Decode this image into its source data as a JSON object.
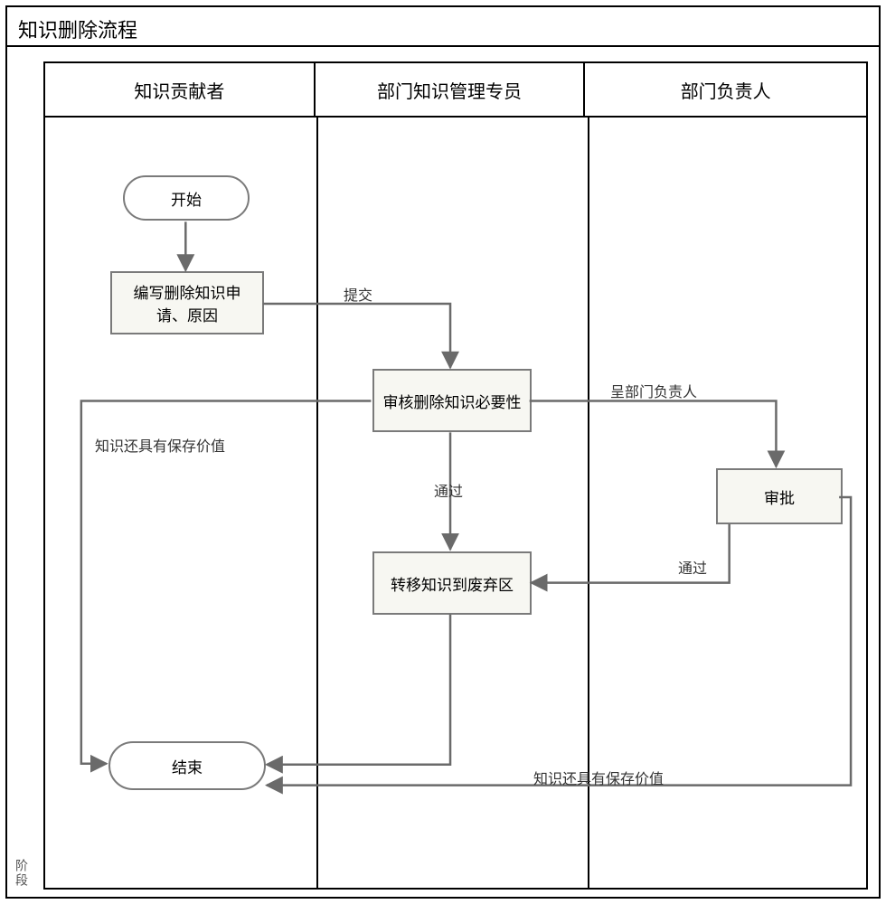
{
  "title": "知识删除流程",
  "vertical_label": "阶段",
  "lanes": {
    "contributor": "知识贡献者",
    "specialist": "部门知识管理专员",
    "manager": "部门负责人"
  },
  "nodes": {
    "start": "开始",
    "write_request": "编写删除知识申请、原因",
    "review_necessity": "审核删除知识必要性",
    "move_archive": "转移知识到废弃区",
    "approve": "审批",
    "end": "结束"
  },
  "edges": {
    "submit": "提交",
    "to_manager": "呈部门负责人",
    "pass1": "通过",
    "pass2": "通过",
    "still_valuable_left": "知识还具有保存价值",
    "still_valuable_right": "知识还具有保存价值"
  }
}
